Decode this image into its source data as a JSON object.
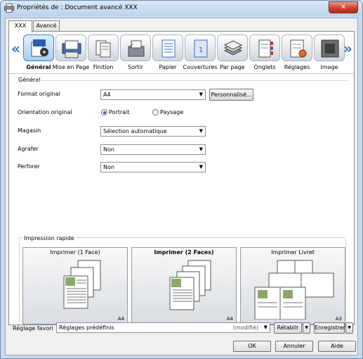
{
  "window": {
    "title": "Propriétés de : Document avancé XXX",
    "close_label": "✕"
  },
  "tabs": [
    {
      "label": "XXX"
    },
    {
      "label": "Avancé"
    }
  ],
  "ribbon": {
    "items": [
      {
        "label": "Général",
        "icon": "general-icon"
      },
      {
        "label": "Mise en Page",
        "icon": "layout-icon"
      },
      {
        "label": "Finition",
        "icon": "finishing-icon"
      },
      {
        "label": "Sortir",
        "icon": "output-icon"
      },
      {
        "label": "Papier",
        "icon": "paper-icon"
      },
      {
        "label": "Couvertures",
        "icon": "covers-icon"
      },
      {
        "label": "Par page",
        "icon": "per-page-icon"
      },
      {
        "label": "Onglets",
        "icon": "tabs-icon"
      },
      {
        "label": "Réglages",
        "icon": "settings-icon"
      },
      {
        "label": "Image",
        "icon": "image-icon"
      }
    ],
    "prev_label": "«",
    "next_label": "»"
  },
  "general": {
    "group_label": "Général",
    "format_label": "Format original",
    "format_value": "A4",
    "custom_button": "Personnalisé...",
    "orientation_label": "Orientation original",
    "portrait_label": "Portrait",
    "landscape_label": "Paysage",
    "tray_label": "Magasin",
    "tray_value": "Sélection automatique",
    "staple_label": "Agrafer",
    "staple_value": "Non",
    "punch_label": "Perforer",
    "punch_value": "Non"
  },
  "quick_print": {
    "title": "Impression rapide",
    "cards": [
      {
        "label": "Imprimer (1 Face)",
        "size": "A4"
      },
      {
        "label": "Imprimer (2 Faces)",
        "size": "A4"
      },
      {
        "label": "Imprimer Livret",
        "size": "A3"
      }
    ]
  },
  "footer": {
    "favorite_label": "Réglage favori",
    "favorite_value": "Réglages prédéfinis",
    "favorite_modified": "(modifié)",
    "restore_button": "Rétablir",
    "save_button": "Enregistrer",
    "ok_button": "OK",
    "cancel_button": "Annuler",
    "help_button": "Aide"
  }
}
